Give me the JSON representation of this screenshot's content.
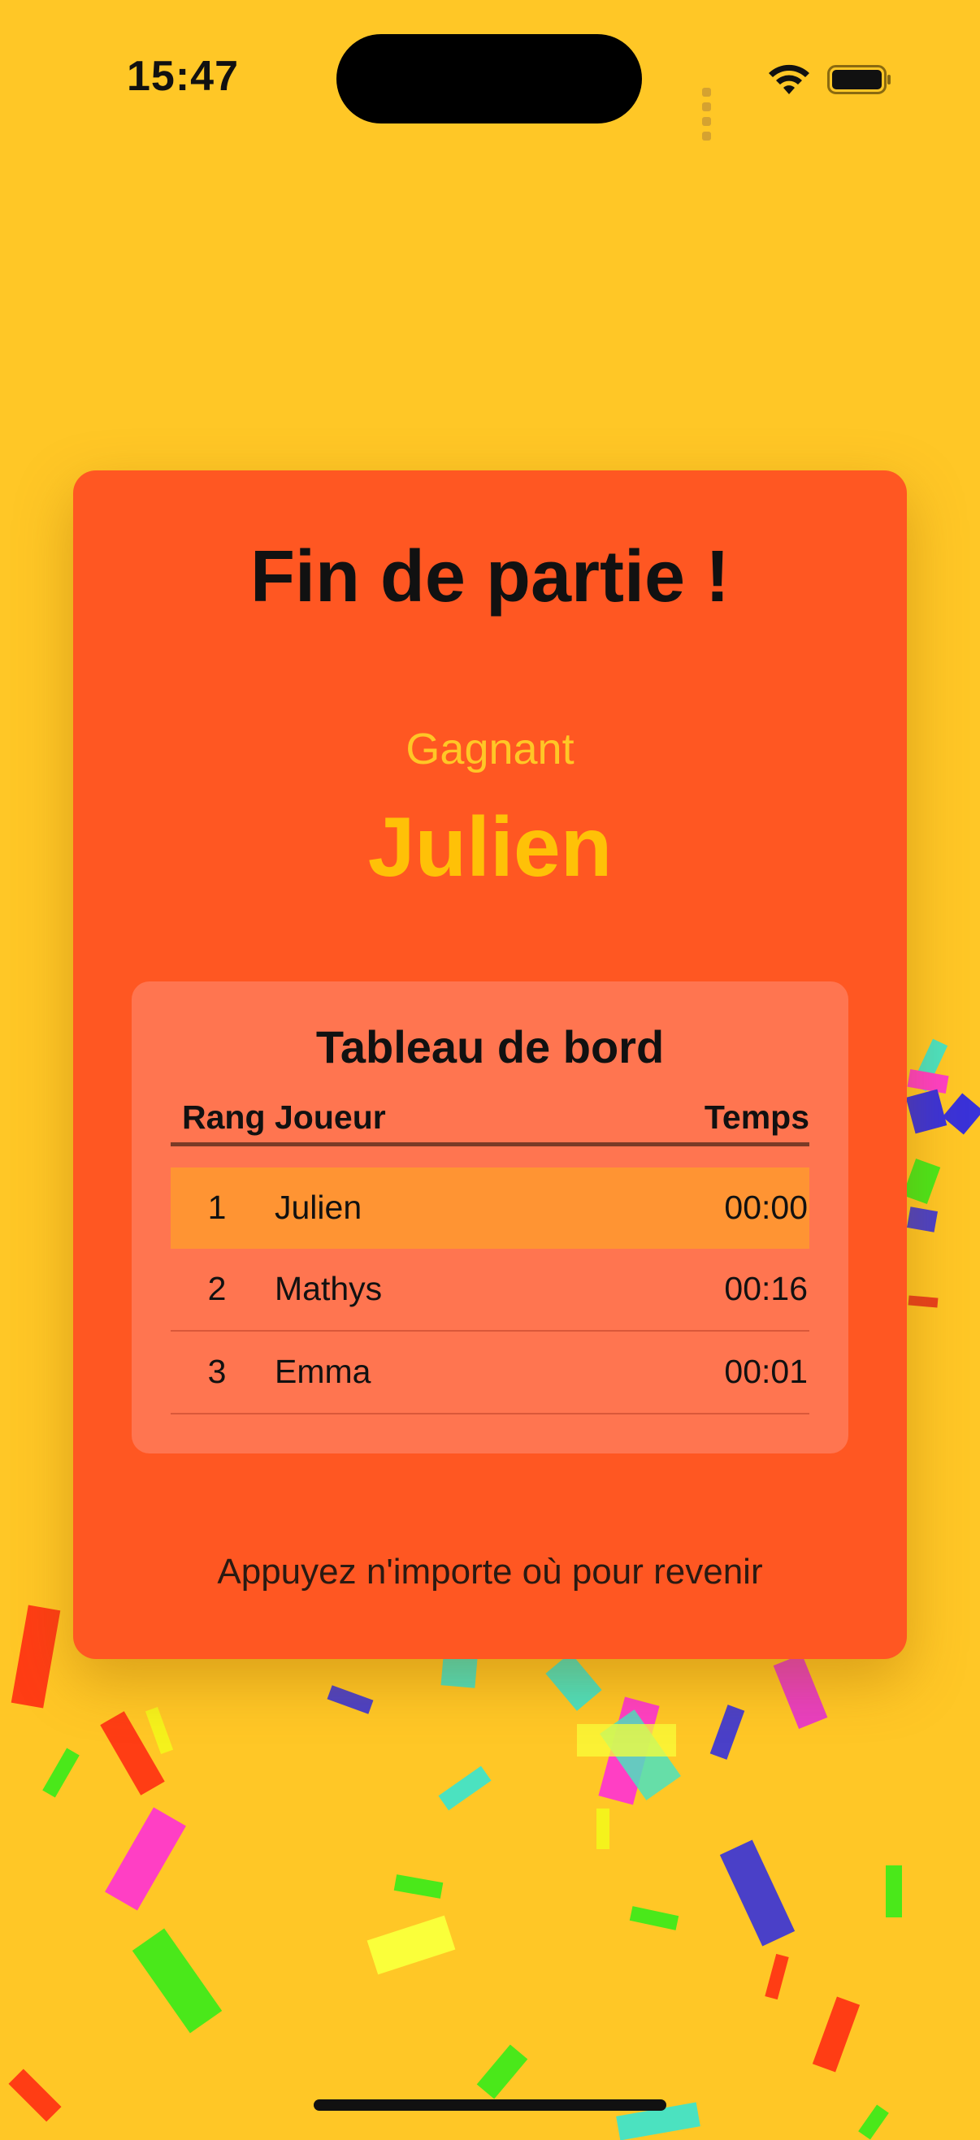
{
  "status": {
    "time": "15:47"
  },
  "card": {
    "title": "Fin de partie !",
    "winner_label": "Gagnant",
    "winner_name": "Julien",
    "hint": "Appuyez n'importe où pour revenir"
  },
  "board": {
    "title": "Tableau de bord",
    "headers": {
      "rank": "Rang",
      "player": "Joueur",
      "time": "Temps"
    },
    "rows": [
      {
        "rank": "1",
        "player": "Julien",
        "time": "00:00",
        "highlighted": true
      },
      {
        "rank": "2",
        "player": "Mathys",
        "time": "00:16"
      },
      {
        "rank": "3",
        "player": "Emma",
        "time": "00:01"
      }
    ]
  },
  "colors": {
    "background": "#FFC726",
    "card": "#FF5722",
    "board": "#FF7550",
    "highlight_row": "#FF9433",
    "winner": "#FFC107"
  }
}
